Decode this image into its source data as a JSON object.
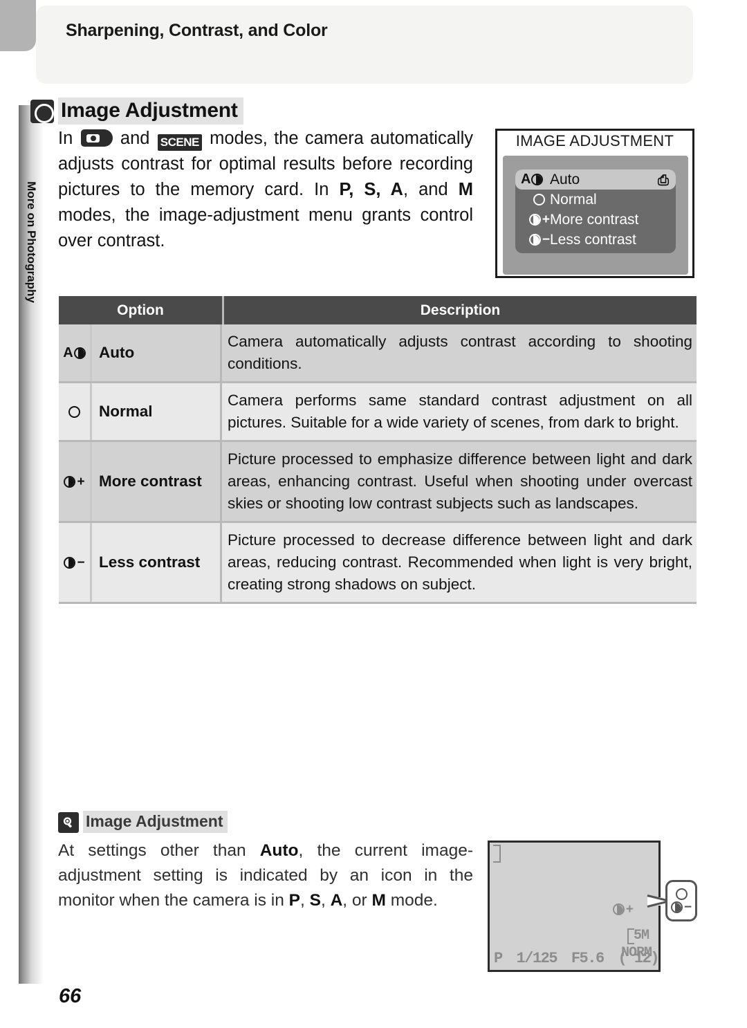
{
  "header": {
    "title": "Sharpening, Contrast, and Color"
  },
  "side_tab": {
    "label": "More on Photography"
  },
  "section": {
    "icon": "circle-outline-icon",
    "title": "Image Adjustment",
    "intro": {
      "part1": "In",
      "icon_auto": "camera-auto-mode-icon",
      "part2": "and",
      "icon_scene": "SCENE",
      "part3": "modes, the camera automatically adjusts contrast for optimal results before recording pictures to the memory card.  In",
      "modes_psa": "P, S, A",
      "part4": ", and",
      "mode_m": "M",
      "part5": "modes, the image-adjustment menu grants control over contrast."
    }
  },
  "menu_screenshot": {
    "title": "IMAGE ADJUSTMENT",
    "enter_icon": "enter-arrow-icon",
    "items": [
      {
        "icon": "auto-contrast-icon",
        "label": "Auto",
        "selected": true
      },
      {
        "icon": "normal-circle-icon",
        "label": "Normal",
        "selected": false
      },
      {
        "icon": "more-contrast-icon",
        "label": "More contrast",
        "selected": false
      },
      {
        "icon": "less-contrast-icon",
        "label": "Less contrast",
        "selected": false
      }
    ]
  },
  "table": {
    "columns": [
      "Option",
      "Description"
    ],
    "rows": [
      {
        "icon": "auto-contrast-icon",
        "option": "Auto",
        "description": "Camera automatically adjusts contrast according to shooting conditions."
      },
      {
        "icon": "normal-circle-icon",
        "option": "Normal",
        "description": "Camera performs same standard contrast adjustment on all pictures.  Suitable for a wide variety of scenes, from dark to bright."
      },
      {
        "icon": "more-contrast-icon",
        "option": "More contrast",
        "description": "Picture processed to emphasize difference between light and dark areas, enhancing contrast.  Useful when shooting under overcast skies or shooting low contrast subjects such as landscapes."
      },
      {
        "icon": "less-contrast-icon",
        "option": "Less contrast",
        "description": "Picture processed to decrease difference between light and dark areas, reducing contrast.  Recommended when light is very bright, creating strong shadows on subject."
      }
    ]
  },
  "note": {
    "icon": "lightbulb-tip-icon",
    "title": "Image Adjustment",
    "text_part1": "At settings other than",
    "bold1": "Auto",
    "text_part2": ", the current image-adjustment setting is indicated by an icon in the monitor when the camera is in",
    "bold2": "P",
    "sep1": ",",
    "bold3": "S",
    "sep2": ",",
    "bold4": "A",
    "sep3": ", or",
    "bold5": "M",
    "text_part3": "mode."
  },
  "monitor": {
    "contrast_icon": "more-contrast-icon",
    "image_size": "5M",
    "image_quality": "NORM",
    "mode": "P",
    "shutter_speed": "1/125",
    "aperture": "F5.6",
    "frames_remaining": "(  12)",
    "callout_icons": [
      "normal-circle-icon",
      "less-contrast-icon"
    ]
  },
  "page_number": "66",
  "colors": {
    "table_header_bg": "#4a4a4a",
    "row_light": "#e9e9e9",
    "row_dark": "#d2d2d2",
    "menu_bg": "#9d9d9d",
    "menu_list_bg": "#6b6b6b",
    "menu_selected_bg": "#c8c8c8",
    "corner_tab": "#b3b3b3",
    "header_bar": "#f4f4f2"
  }
}
